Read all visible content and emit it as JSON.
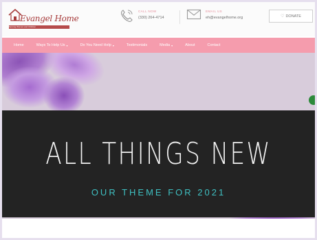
{
  "brand": {
    "name": "Evangel Home",
    "tagline": "Serving Women and Children"
  },
  "contact": {
    "phone_label": "CALL NOW",
    "phone": "(330) 264-4714",
    "email_label": "EMAIL US",
    "email": "eh@evangelhome.org"
  },
  "donate_label": "DONATE",
  "nav": [
    {
      "label": "Home",
      "has_menu": false
    },
    {
      "label": "Ways To Help Us",
      "has_menu": true
    },
    {
      "label": "Do You Need Help",
      "has_menu": true
    },
    {
      "label": "Testimonials",
      "has_menu": false
    },
    {
      "label": "Media",
      "has_menu": true
    },
    {
      "label": "About",
      "has_menu": false
    },
    {
      "label": "Contact",
      "has_menu": false
    }
  ],
  "hero": {
    "title": "ALL THINGS NEW",
    "subtitle": "OUR THEME FOR 2021"
  },
  "colors": {
    "nav": "#f59cad",
    "banner": "#232323",
    "accent": "#3fc1c3"
  },
  "icons": {
    "phone": "phone-icon",
    "email": "envelope-icon",
    "donate": "heart-icon",
    "caret": "chevron-down-icon"
  }
}
